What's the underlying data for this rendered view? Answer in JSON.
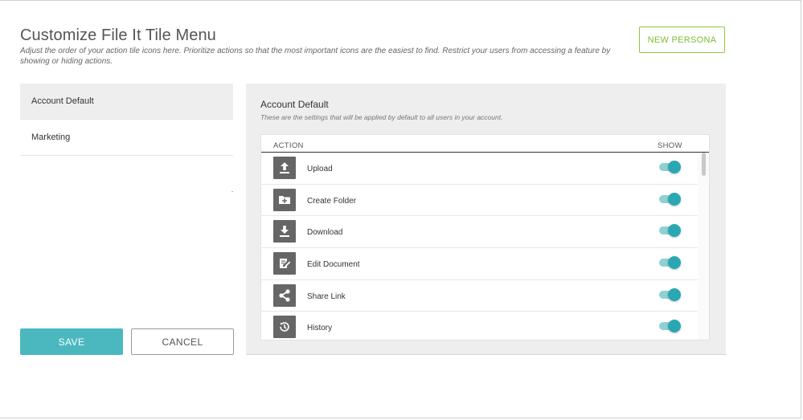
{
  "header": {
    "title": "Customize File It Tile Menu",
    "description": "Adjust the order of your action tile icons here. Prioritize actions so that the most important icons are the easiest to find. Restrict your users from accessing a feature by showing or hiding actions.",
    "new_persona_label": "NEW PERSONA"
  },
  "personas": {
    "items": [
      {
        "label": "Account Default",
        "active": true
      },
      {
        "label": "Marketing",
        "active": false
      }
    ]
  },
  "buttons": {
    "save_label": "SAVE",
    "cancel_label": "CANCEL"
  },
  "panel": {
    "title": "Account Default",
    "description": "These are the settings that will be applied by default to all users in your account.",
    "table": {
      "col_action": "ACTION",
      "col_show": "SHOW",
      "rows": [
        {
          "label": "Upload",
          "icon": "upload-icon",
          "show": true
        },
        {
          "label": "Create Folder",
          "icon": "create-folder-icon",
          "show": true
        },
        {
          "label": "Download",
          "icon": "download-icon",
          "show": true
        },
        {
          "label": "Edit Document",
          "icon": "edit-document-icon",
          "show": true
        },
        {
          "label": "Share Link",
          "icon": "share-link-icon",
          "show": true
        },
        {
          "label": "History",
          "icon": "history-icon",
          "show": true
        }
      ]
    }
  },
  "colors": {
    "accent_teal": "#2aa8b2",
    "save_button": "#4bb8c0",
    "new_persona_green": "#8dc63f",
    "icon_tile": "#666666"
  }
}
